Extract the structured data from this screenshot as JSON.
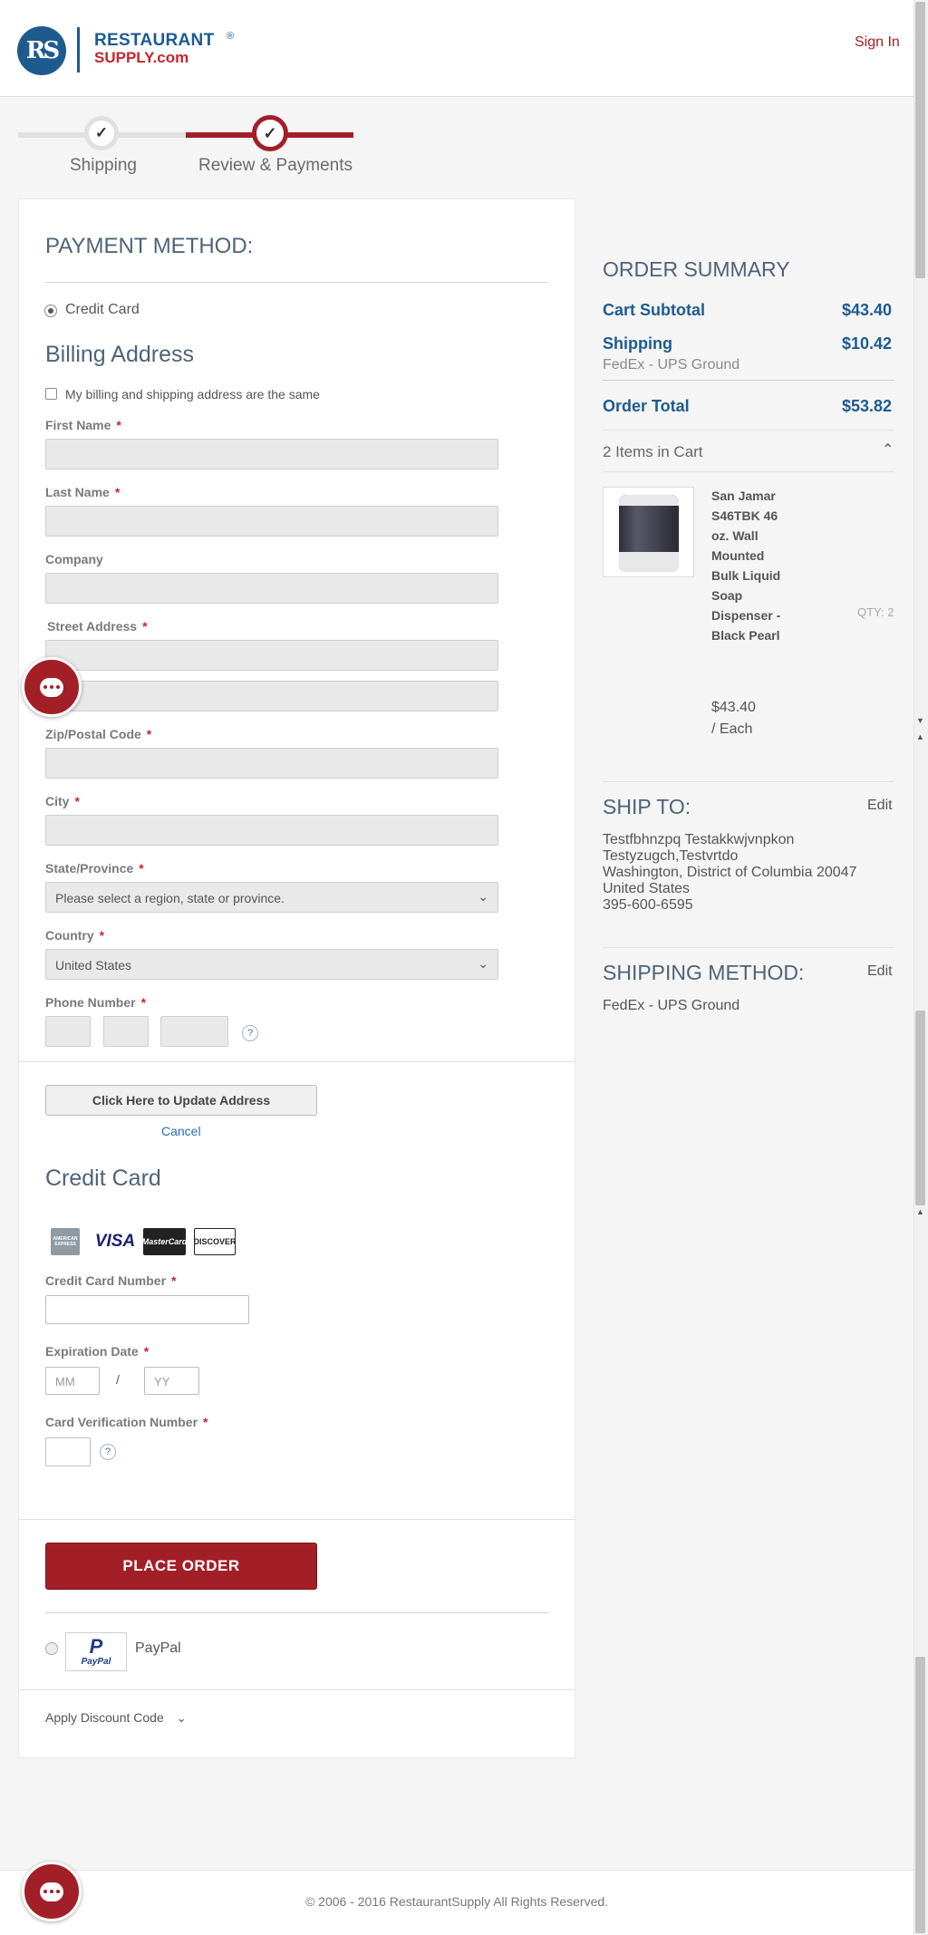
{
  "header": {
    "logo_initials": "RS",
    "logo_line1": "RESTAURANT",
    "logo_reg": "®",
    "logo_line2": "SUPPLY.com",
    "sign_in": "Sign In"
  },
  "progress": {
    "steps": [
      {
        "label": "Shipping",
        "status": "complete"
      },
      {
        "label": "Review & Payments",
        "status": "current"
      }
    ],
    "check": "✓"
  },
  "payment": {
    "title": "PAYMENT METHOD:",
    "credit_card_option": "Credit Card",
    "billing_title": "Billing Address",
    "same_address_label": "My billing and shipping address are the same",
    "required_mark": "*",
    "fields": {
      "first_name": "First Name",
      "last_name": "Last Name",
      "company": "Company",
      "street": "Street Address",
      "zip": "Zip/Postal Code",
      "city": "City",
      "state": "State/Province",
      "country": "Country",
      "phone": "Phone Number"
    },
    "state_placeholder": "Please select a region, state or province.",
    "country_value": "United States",
    "help": "?",
    "update_button": "Click Here to Update Address",
    "cancel": "Cancel",
    "cc_title": "Credit Card",
    "card_logos": [
      "AMERICAN EXPRESS",
      "VISA",
      "MasterCard",
      "DISCOVER"
    ],
    "cc_number_label": "Credit Card Number",
    "expiration_label": "Expiration Date",
    "mm_placeholder": "MM",
    "slash": "/",
    "yy_placeholder": "YY",
    "cvv_label": "Card Verification Number",
    "place_order": "PLACE ORDER",
    "paypal_logo": "PayPal",
    "paypal_label": "PayPal",
    "discount": "Apply Discount Code"
  },
  "summary": {
    "title": "ORDER SUMMARY",
    "subtotal_label": "Cart Subtotal",
    "subtotal_value": "$43.40",
    "shipping_label": "Shipping",
    "shipping_value": "$10.42",
    "shipping_method": "FedEx - UPS Ground",
    "total_label": "Order Total",
    "total_value": "$53.82",
    "items_label": "2 Items in Cart",
    "product_name": "San Jamar S46TBK 46 oz. Wall Mounted Bulk Liquid Soap Dispenser - Black Pearl",
    "qty": "QTY: 2",
    "price": "$43.40",
    "price_unit": "/ Each"
  },
  "ship_to": {
    "title": "SHIP TO:",
    "edit": "Edit",
    "lines": [
      "Testfbhnzpq Testakkwjvnpkon",
      "Testyzugch,Testvrtdo",
      "Washington, District of Columbia 20047",
      "United States",
      "395-600-6595"
    ]
  },
  "shipping_method": {
    "title": "SHIPPING METHOD:",
    "edit": "Edit",
    "value": "FedEx - UPS Ground"
  },
  "footer": {
    "copyright": "© 2006 - 2016 RestaurantSupply All Rights Reserved."
  }
}
